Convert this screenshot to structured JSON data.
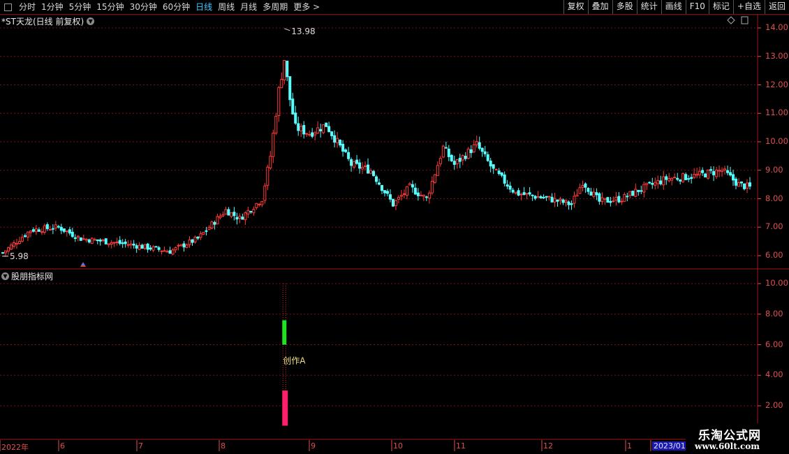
{
  "toolbar": {
    "periods": [
      "分时",
      "1分钟",
      "5分钟",
      "15分钟",
      "30分钟",
      "60分钟",
      "日线",
      "周线",
      "月线",
      "多周期",
      "更多 >"
    ],
    "active_period": "日线",
    "tools": [
      "复权",
      "叠加",
      "多股",
      "统计",
      "画线",
      "F10",
      "标记",
      "+自选",
      "返回"
    ]
  },
  "stock": {
    "title": "*ST天龙(日线 前复权)"
  },
  "indicator": {
    "title": "股朋指标网",
    "signal_label": "创作A"
  },
  "colors": {
    "up": "#ff3a3a",
    "down": "#54ffff",
    "grid": "#7a1010",
    "axis": "#e05050",
    "green_bar": "#22e022",
    "pink_bar": "#ff1f6a"
  },
  "chart_data": [
    {
      "type": "candlestick",
      "title": "*ST天龙(日线 前复权)",
      "ylim": [
        5.6,
        14.3
      ],
      "yticks": [
        "14.00",
        "13.00",
        "12.00",
        "11.00",
        "10.00",
        "9.00",
        "8.00",
        "7.00",
        "6.00"
      ],
      "high_label": "13.98",
      "low_label": "5.98",
      "x_labels": [
        "2022年",
        "6",
        "7",
        "8",
        "9",
        "10",
        "11",
        "12",
        "1",
        "2023/01"
      ],
      "trend_close": [
        [
          0,
          6.1
        ],
        [
          10,
          6.9
        ],
        [
          20,
          7.0
        ],
        [
          28,
          6.6
        ],
        [
          45,
          6.4
        ],
        [
          60,
          6.15
        ],
        [
          70,
          6.6
        ],
        [
          80,
          7.6
        ],
        [
          85,
          7.3
        ],
        [
          93,
          8.0
        ],
        [
          96,
          9.5
        ],
        [
          99,
          11.8
        ],
        [
          101,
          12.9
        ],
        [
          103,
          11.5
        ],
        [
          105,
          10.5
        ],
        [
          110,
          10.3
        ],
        [
          116,
          10.6
        ],
        [
          125,
          9.2
        ],
        [
          132,
          9.0
        ],
        [
          140,
          7.8
        ],
        [
          146,
          8.4
        ],
        [
          152,
          8.0
        ],
        [
          158,
          9.8
        ],
        [
          162,
          9.2
        ],
        [
          170,
          9.9
        ],
        [
          176,
          9.0
        ],
        [
          184,
          8.2
        ],
        [
          196,
          8.0
        ],
        [
          204,
          7.8
        ],
        [
          208,
          8.6
        ],
        [
          214,
          7.9
        ],
        [
          222,
          8.0
        ],
        [
          228,
          8.3
        ],
        [
          238,
          8.7
        ],
        [
          248,
          8.8
        ],
        [
          258,
          9.0
        ],
        [
          264,
          8.5
        ],
        [
          268,
          8.4
        ]
      ],
      "n_days": 269
    },
    {
      "type": "bar",
      "title": "股朋指标网",
      "ylim": [
        1.0,
        10.5
      ],
      "yticks": [
        "10.00",
        "8.00",
        "6.00",
        "4.00",
        "2.00"
      ],
      "series": [
        {
          "name": "green",
          "range": [
            6.0,
            7.6
          ]
        },
        {
          "name": "pink",
          "range": [
            0.7,
            3.0
          ]
        }
      ],
      "signal_top": 10.0
    }
  ],
  "watermark": {
    "line1": "乐淘公式网",
    "line2": "www.60lt.com"
  }
}
